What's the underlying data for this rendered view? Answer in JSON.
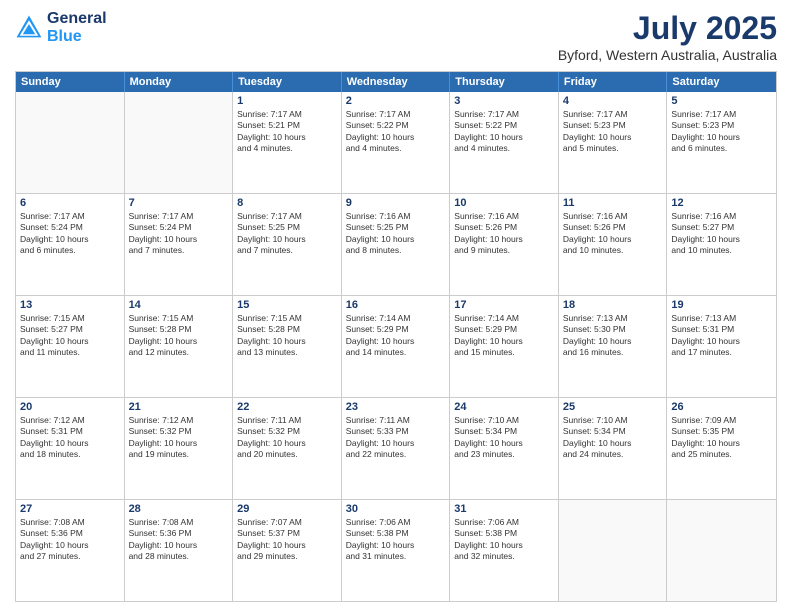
{
  "header": {
    "logo_line1": "General",
    "logo_line2": "Blue",
    "month": "July 2025",
    "location": "Byford, Western Australia, Australia"
  },
  "days_of_week": [
    "Sunday",
    "Monday",
    "Tuesday",
    "Wednesday",
    "Thursday",
    "Friday",
    "Saturday"
  ],
  "weeks": [
    [
      {
        "day": "",
        "info": ""
      },
      {
        "day": "",
        "info": ""
      },
      {
        "day": "1",
        "info": "Sunrise: 7:17 AM\nSunset: 5:21 PM\nDaylight: 10 hours\nand 4 minutes."
      },
      {
        "day": "2",
        "info": "Sunrise: 7:17 AM\nSunset: 5:22 PM\nDaylight: 10 hours\nand 4 minutes."
      },
      {
        "day": "3",
        "info": "Sunrise: 7:17 AM\nSunset: 5:22 PM\nDaylight: 10 hours\nand 4 minutes."
      },
      {
        "day": "4",
        "info": "Sunrise: 7:17 AM\nSunset: 5:23 PM\nDaylight: 10 hours\nand 5 minutes."
      },
      {
        "day": "5",
        "info": "Sunrise: 7:17 AM\nSunset: 5:23 PM\nDaylight: 10 hours\nand 6 minutes."
      }
    ],
    [
      {
        "day": "6",
        "info": "Sunrise: 7:17 AM\nSunset: 5:24 PM\nDaylight: 10 hours\nand 6 minutes."
      },
      {
        "day": "7",
        "info": "Sunrise: 7:17 AM\nSunset: 5:24 PM\nDaylight: 10 hours\nand 7 minutes."
      },
      {
        "day": "8",
        "info": "Sunrise: 7:17 AM\nSunset: 5:25 PM\nDaylight: 10 hours\nand 7 minutes."
      },
      {
        "day": "9",
        "info": "Sunrise: 7:16 AM\nSunset: 5:25 PM\nDaylight: 10 hours\nand 8 minutes."
      },
      {
        "day": "10",
        "info": "Sunrise: 7:16 AM\nSunset: 5:26 PM\nDaylight: 10 hours\nand 9 minutes."
      },
      {
        "day": "11",
        "info": "Sunrise: 7:16 AM\nSunset: 5:26 PM\nDaylight: 10 hours\nand 10 minutes."
      },
      {
        "day": "12",
        "info": "Sunrise: 7:16 AM\nSunset: 5:27 PM\nDaylight: 10 hours\nand 10 minutes."
      }
    ],
    [
      {
        "day": "13",
        "info": "Sunrise: 7:15 AM\nSunset: 5:27 PM\nDaylight: 10 hours\nand 11 minutes."
      },
      {
        "day": "14",
        "info": "Sunrise: 7:15 AM\nSunset: 5:28 PM\nDaylight: 10 hours\nand 12 minutes."
      },
      {
        "day": "15",
        "info": "Sunrise: 7:15 AM\nSunset: 5:28 PM\nDaylight: 10 hours\nand 13 minutes."
      },
      {
        "day": "16",
        "info": "Sunrise: 7:14 AM\nSunset: 5:29 PM\nDaylight: 10 hours\nand 14 minutes."
      },
      {
        "day": "17",
        "info": "Sunrise: 7:14 AM\nSunset: 5:29 PM\nDaylight: 10 hours\nand 15 minutes."
      },
      {
        "day": "18",
        "info": "Sunrise: 7:13 AM\nSunset: 5:30 PM\nDaylight: 10 hours\nand 16 minutes."
      },
      {
        "day": "19",
        "info": "Sunrise: 7:13 AM\nSunset: 5:31 PM\nDaylight: 10 hours\nand 17 minutes."
      }
    ],
    [
      {
        "day": "20",
        "info": "Sunrise: 7:12 AM\nSunset: 5:31 PM\nDaylight: 10 hours\nand 18 minutes."
      },
      {
        "day": "21",
        "info": "Sunrise: 7:12 AM\nSunset: 5:32 PM\nDaylight: 10 hours\nand 19 minutes."
      },
      {
        "day": "22",
        "info": "Sunrise: 7:11 AM\nSunset: 5:32 PM\nDaylight: 10 hours\nand 20 minutes."
      },
      {
        "day": "23",
        "info": "Sunrise: 7:11 AM\nSunset: 5:33 PM\nDaylight: 10 hours\nand 22 minutes."
      },
      {
        "day": "24",
        "info": "Sunrise: 7:10 AM\nSunset: 5:34 PM\nDaylight: 10 hours\nand 23 minutes."
      },
      {
        "day": "25",
        "info": "Sunrise: 7:10 AM\nSunset: 5:34 PM\nDaylight: 10 hours\nand 24 minutes."
      },
      {
        "day": "26",
        "info": "Sunrise: 7:09 AM\nSunset: 5:35 PM\nDaylight: 10 hours\nand 25 minutes."
      }
    ],
    [
      {
        "day": "27",
        "info": "Sunrise: 7:08 AM\nSunset: 5:36 PM\nDaylight: 10 hours\nand 27 minutes."
      },
      {
        "day": "28",
        "info": "Sunrise: 7:08 AM\nSunset: 5:36 PM\nDaylight: 10 hours\nand 28 minutes."
      },
      {
        "day": "29",
        "info": "Sunrise: 7:07 AM\nSunset: 5:37 PM\nDaylight: 10 hours\nand 29 minutes."
      },
      {
        "day": "30",
        "info": "Sunrise: 7:06 AM\nSunset: 5:38 PM\nDaylight: 10 hours\nand 31 minutes."
      },
      {
        "day": "31",
        "info": "Sunrise: 7:06 AM\nSunset: 5:38 PM\nDaylight: 10 hours\nand 32 minutes."
      },
      {
        "day": "",
        "info": ""
      },
      {
        "day": "",
        "info": ""
      }
    ]
  ]
}
